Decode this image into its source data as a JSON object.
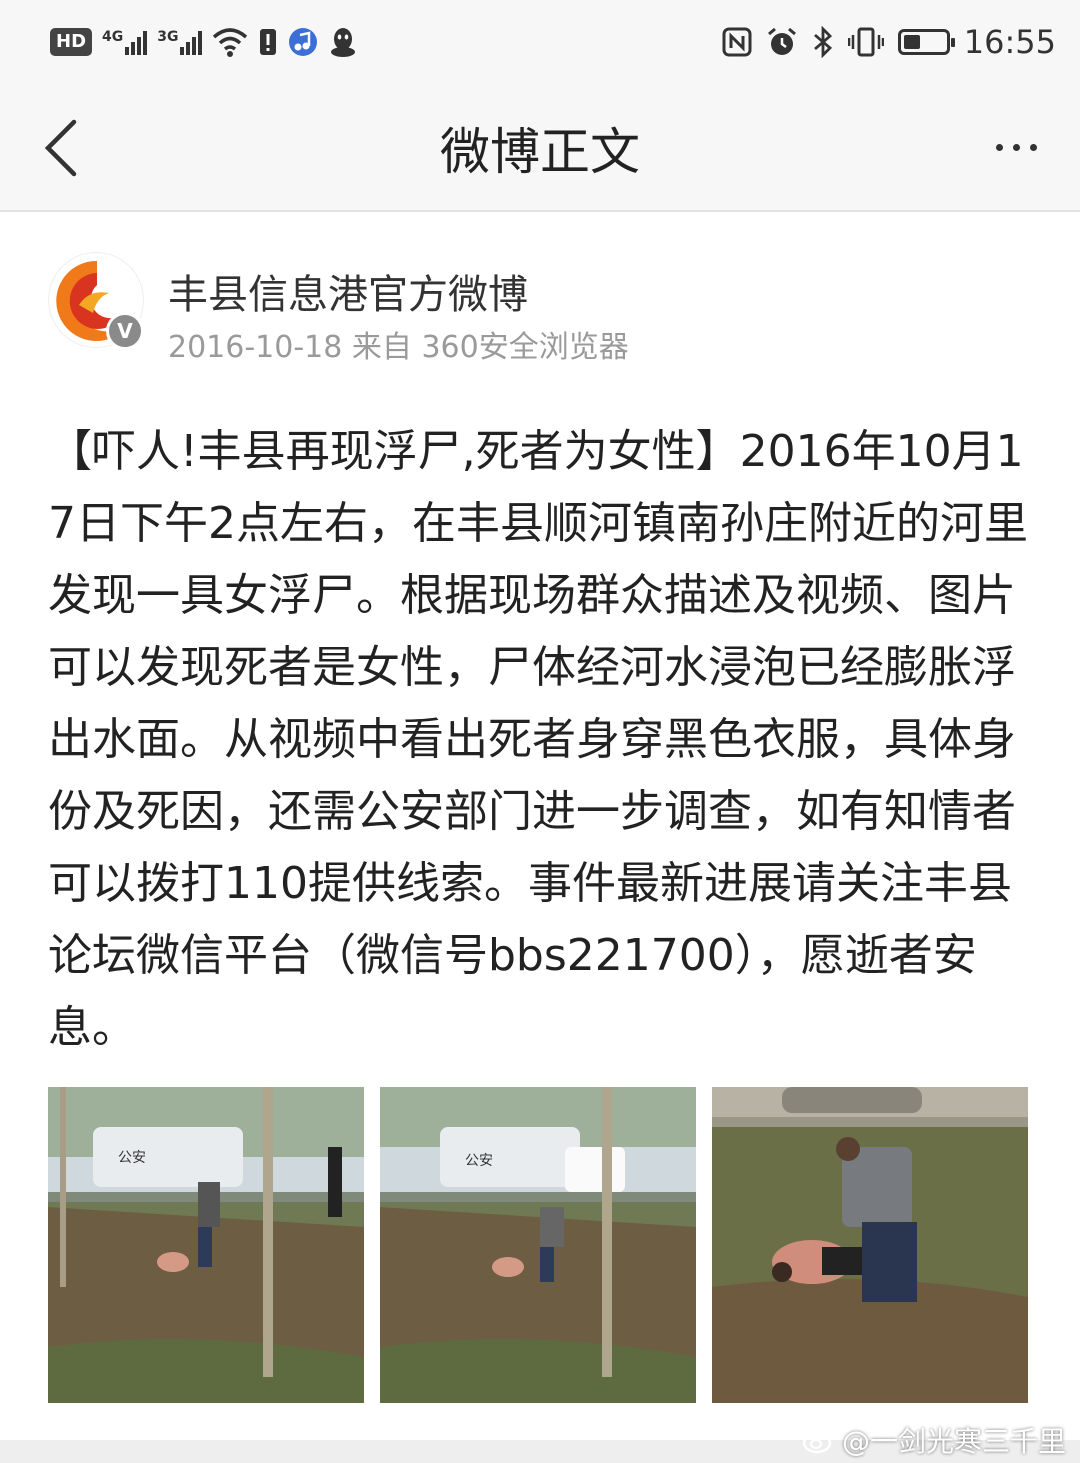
{
  "status_bar": {
    "hd_label": "HD",
    "sim1_gen": "4G",
    "sim2_gen": "3G",
    "time": "16:55",
    "battery_level": 0.4,
    "icons": [
      "wifi-icon",
      "alert-icon",
      "music-app-icon",
      "qq-icon",
      "nfc-icon",
      "alarm-icon",
      "bluetooth-icon",
      "vibrate-icon",
      "battery-icon"
    ]
  },
  "nav": {
    "title": "微博正文",
    "back_icon": "chevron-left-icon",
    "more_icon": "more-dots-icon"
  },
  "post": {
    "author": "丰县信息港官方微博",
    "date": "2016-10-18",
    "source": "来自 360安全浏览器",
    "verified_badge": "V",
    "text": "【吓人!丰县再现浮尸,死者为女性】2016年10月17日下午2点左右，在丰县顺河镇南孙庄附近的河里发现一具女浮尸。根据现场群众描述及视频、图片可以发现死者是女性，尸体经河水浸泡已经膨胀浮出水面。从视频中看出死者身穿黑色衣服，具体身份及死因，还需公安部门进一步调查，如有知情者可以拨打110提供线索。事件最新进展请关注丰县论坛微信平台（微信号bbs221700），愿逝者安息。",
    "photos": [
      {
        "name": "photo-1",
        "car_label": "公安"
      },
      {
        "name": "photo-2",
        "car_label": "公安"
      },
      {
        "name": "photo-3"
      }
    ]
  },
  "watermark": "@一剑光寒三千里",
  "colors": {
    "bar_bg": "#f7f7f7",
    "meta_gray": "#9a9a9a",
    "text": "#222222",
    "logo_orange": "#f07a1a",
    "logo_red": "#d8341f"
  }
}
